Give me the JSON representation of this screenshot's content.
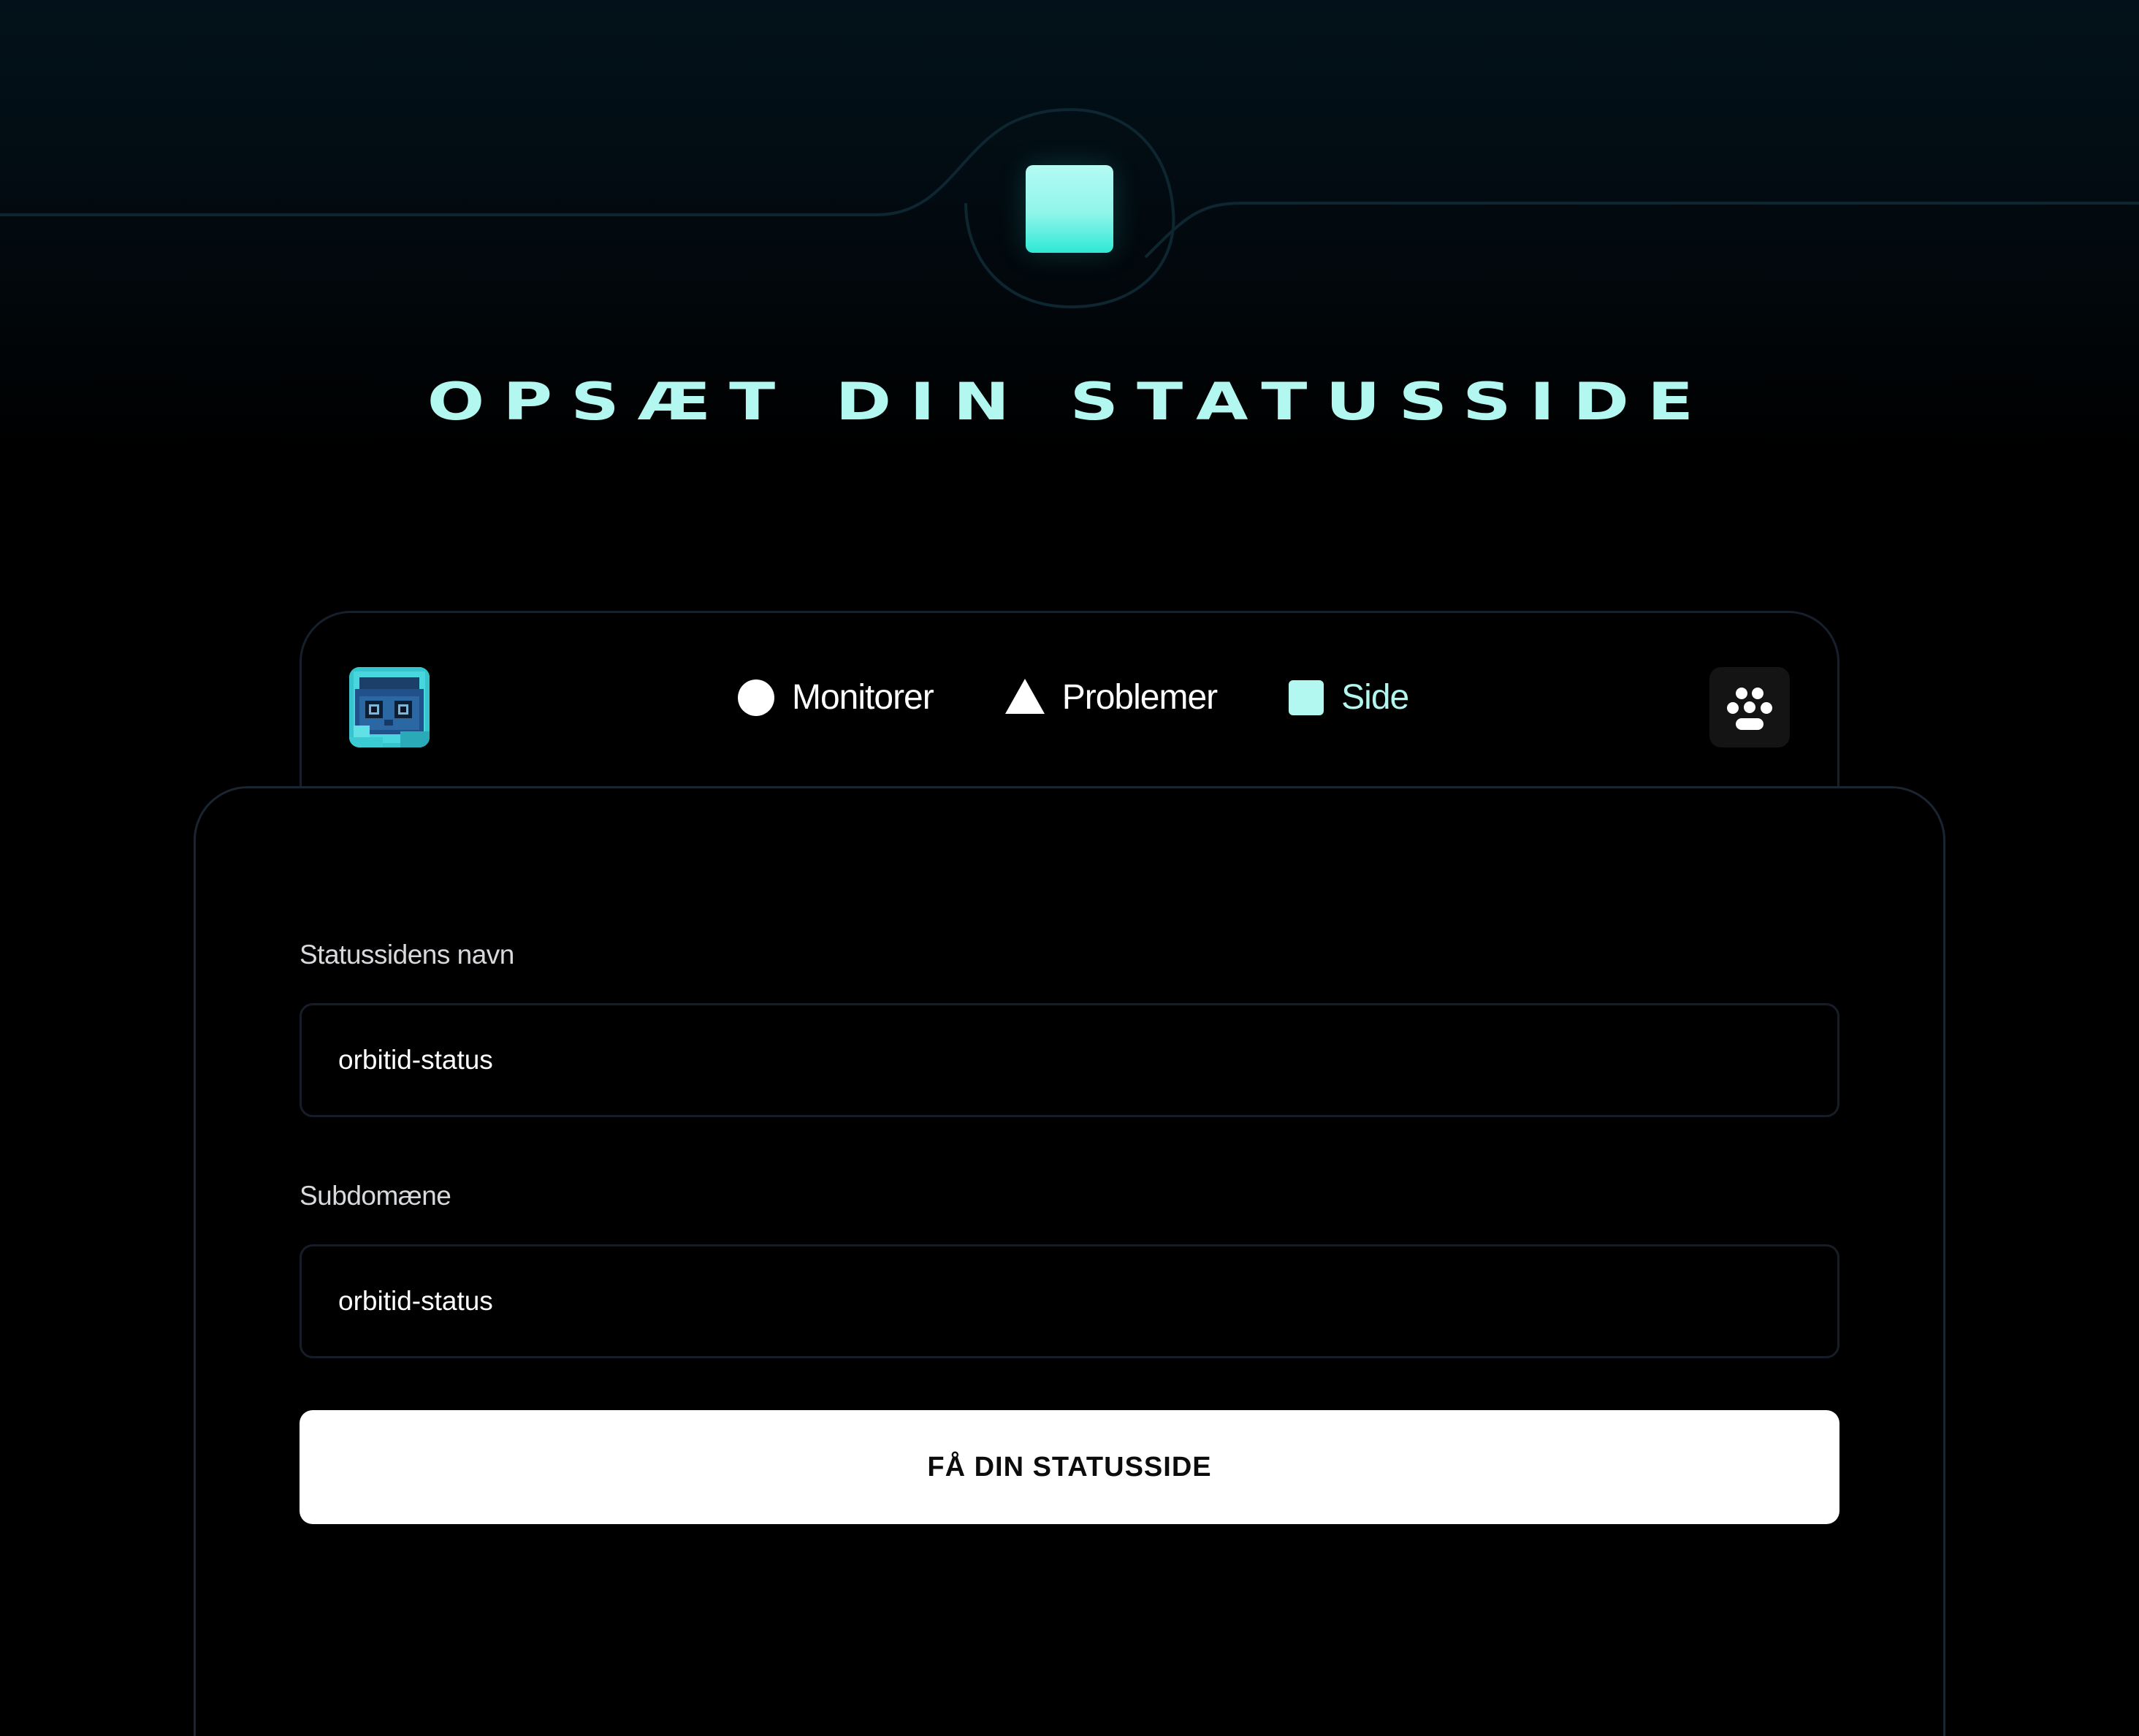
{
  "hero": {
    "icon": "square-icon",
    "title": "OPSÆT DIN STATUSSIDE"
  },
  "nav": {
    "avatar_icon": "pixel-avatar-icon",
    "items": [
      {
        "label": "Monitorer",
        "icon": "circle-icon",
        "active": false
      },
      {
        "label": "Problemer",
        "icon": "triangle-icon",
        "active": false
      },
      {
        "label": "Side",
        "icon": "square-icon",
        "active": true
      }
    ],
    "menu_icon": "paw-icon"
  },
  "form": {
    "name_label": "Statussidens navn",
    "name_value": "orbitid-status",
    "subdomain_label": "Subdomæne",
    "subdomain_value": "orbitid-status",
    "submit_label": "FÅ DIN STATUSSIDE"
  },
  "colors": {
    "accent": "#b2f7f0",
    "background": "#000000",
    "button": "#ffffff",
    "border": "#1b2431"
  }
}
